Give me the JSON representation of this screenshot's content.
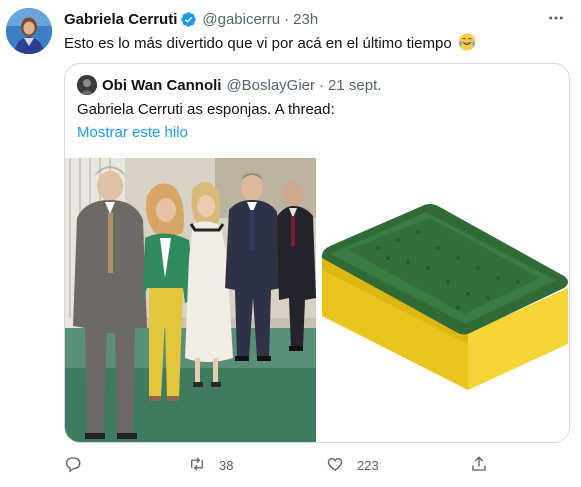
{
  "author": {
    "name": "Gabriela Cerruti",
    "handle": "@gabicerru",
    "separator": "·",
    "time": "23h",
    "verified": true
  },
  "tweet": {
    "text": "Esto es lo más divertido que vi por acá en el último tiempo",
    "emoji": "face-with-tears-of-joy"
  },
  "quoted": {
    "name": "Obi Wan Cannoli",
    "handle": "@BoslayGier",
    "separator": "·",
    "time": "21 sept.",
    "text": "Gabriela Cerruti as esponjas. A thread:",
    "link": "Mostrar este hilo",
    "media": [
      "group-photo",
      "kitchen-sponge-image"
    ]
  },
  "actions": {
    "reply_icon": "reply-icon",
    "retweet_icon": "retweet-icon",
    "retweet_count": "38",
    "like_icon": "heart-icon",
    "like_count": "223",
    "share_icon": "share-icon"
  },
  "colors": {
    "link": "#1d9bf0",
    "verified": "#1d9bf0",
    "secondary_text": "#536471",
    "border": "#cfd9de"
  }
}
